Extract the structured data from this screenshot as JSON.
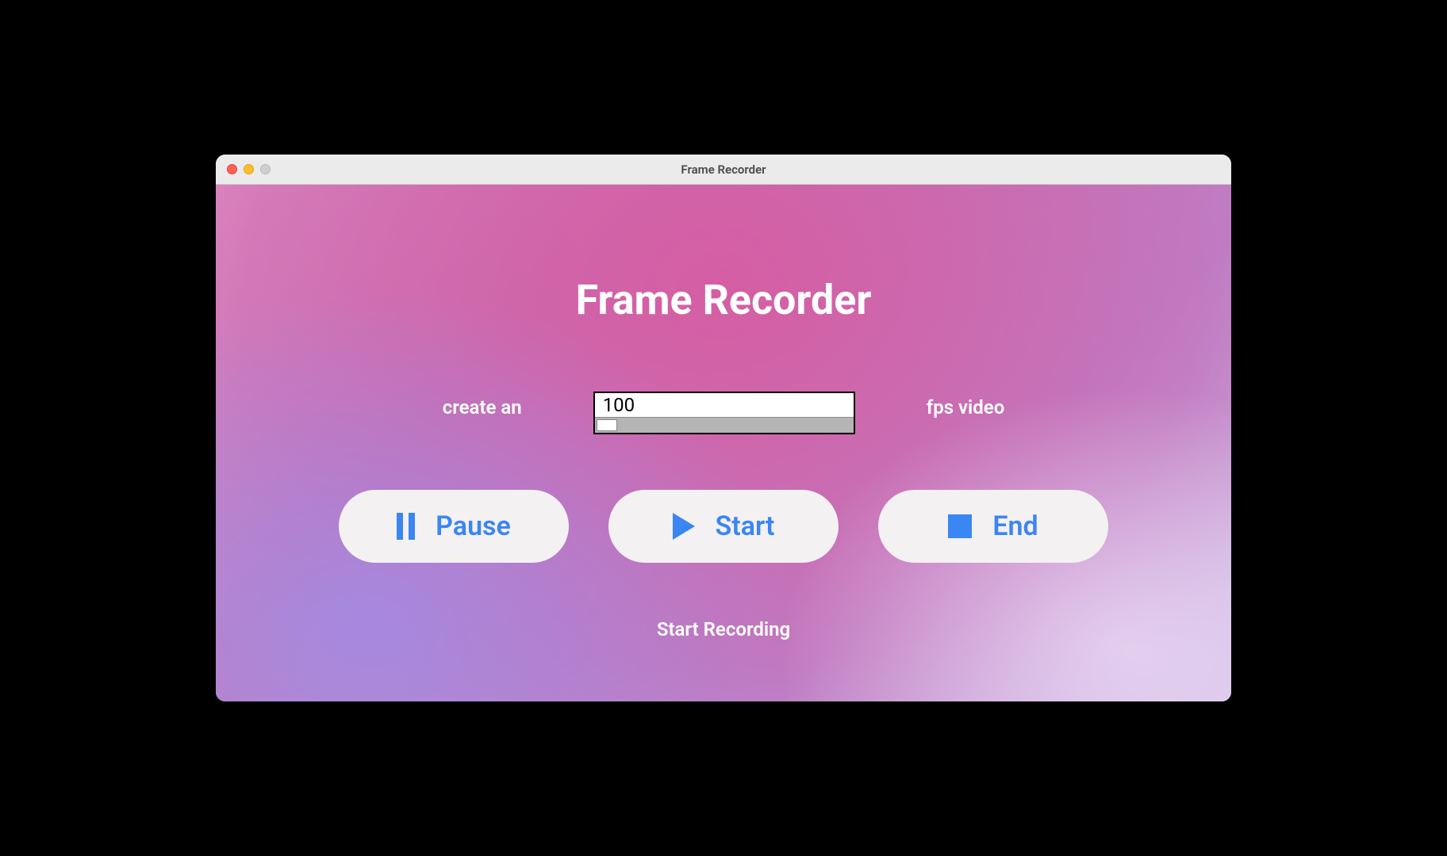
{
  "window": {
    "title": "Frame Recorder"
  },
  "header": {
    "title": "Frame Recorder"
  },
  "fps": {
    "prefix": "create an",
    "value": "100",
    "suffix": "fps video"
  },
  "buttons": {
    "pause": "Pause",
    "start": "Start",
    "end": "End"
  },
  "status": {
    "text": "Start Recording"
  },
  "colors": {
    "accent": "#3a86f2"
  }
}
